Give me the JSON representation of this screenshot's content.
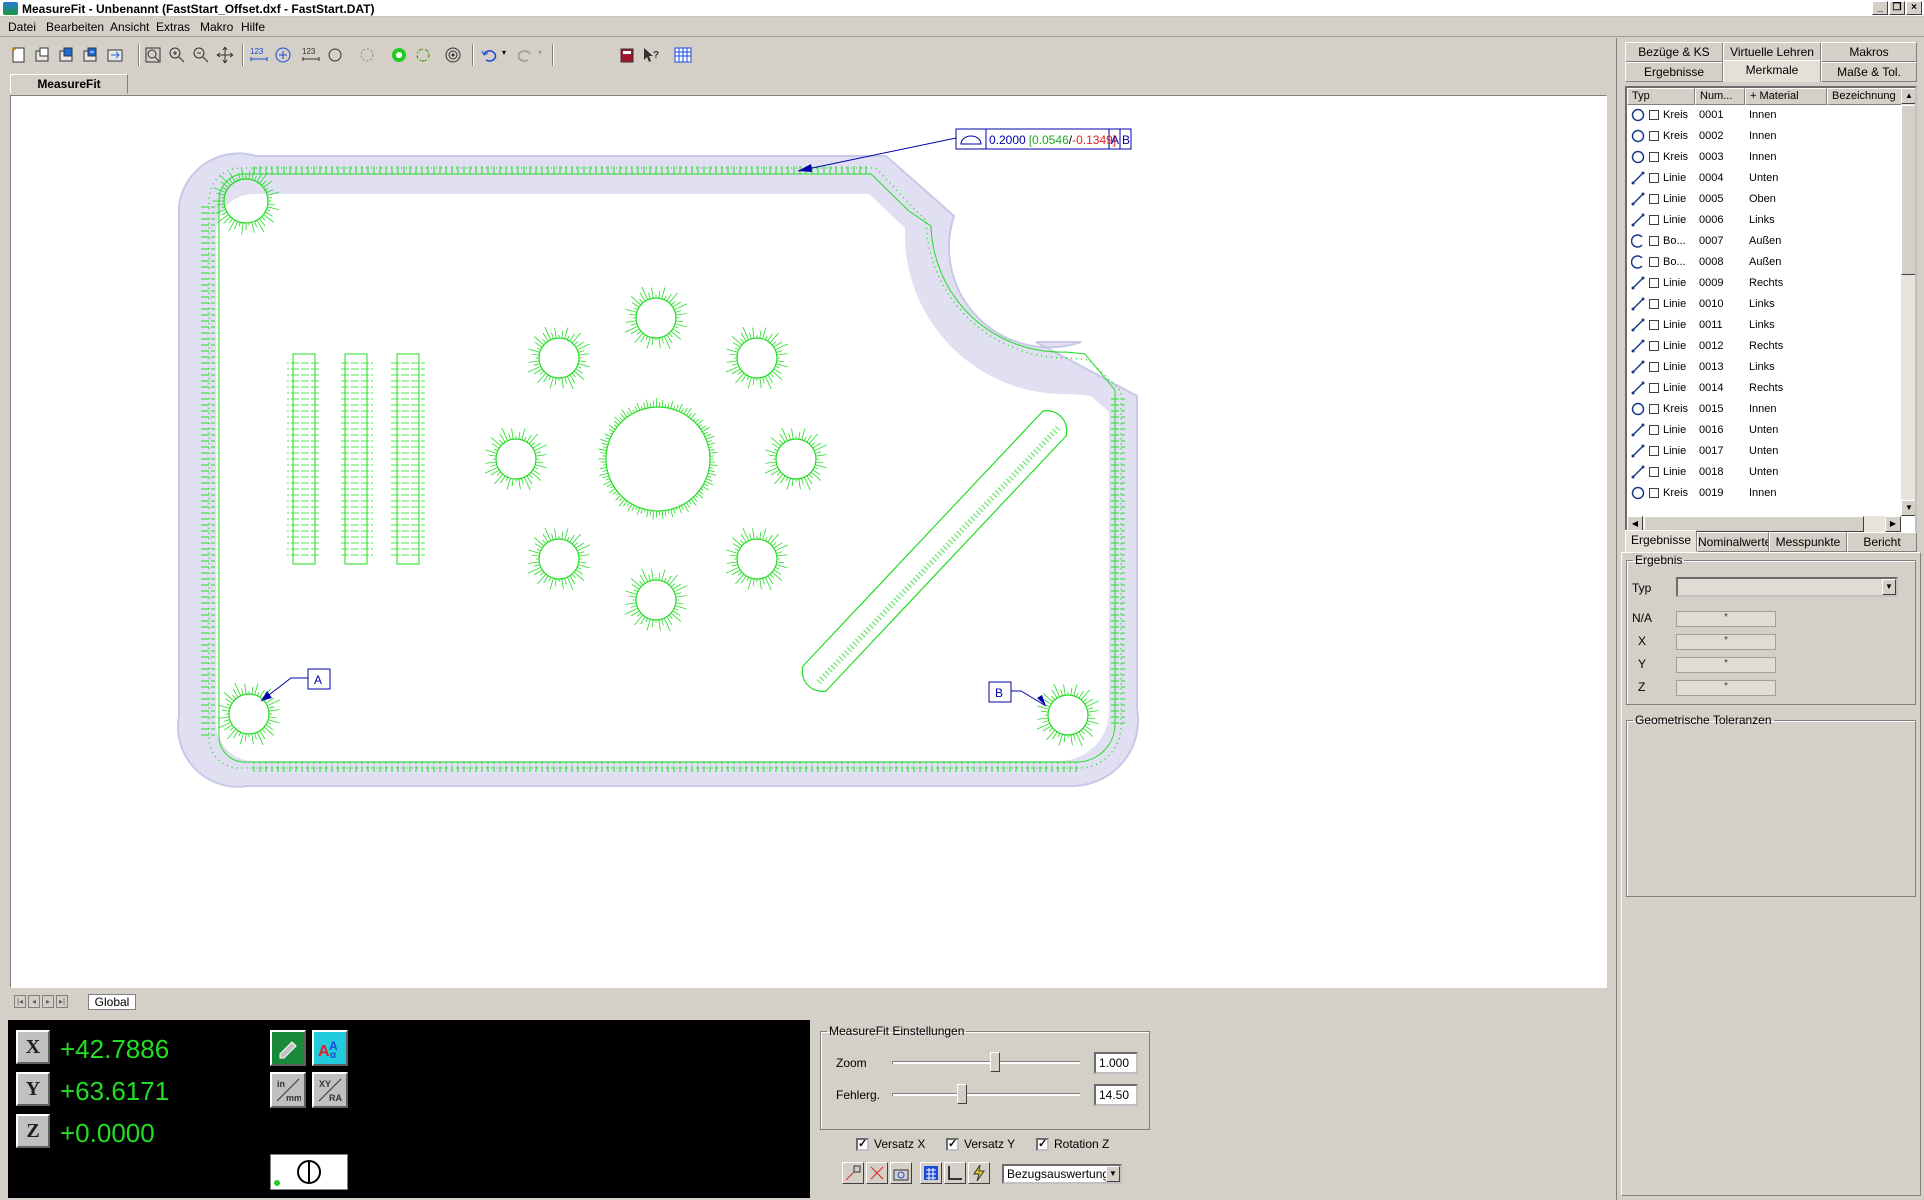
{
  "window": {
    "title": "MeasureFit - Unbenannt (FastStart_Offset.dxf - FastStart.DAT)"
  },
  "menu": [
    "Datei",
    "Bearbeiten",
    "Ansicht",
    "Extras",
    "Makro",
    "Hilfe"
  ],
  "doc_tab": "MeasureFit",
  "sheet_tab": "Global",
  "annotation": {
    "tolerance": "0.2000",
    "dev_open": "[",
    "dev_plus": "0.0546",
    "dev_sep": "/",
    "dev_minus": "-0.1349",
    "dev_close": "]",
    "datum_a": "A",
    "datum_b": "B"
  },
  "coords": {
    "x_label": "X",
    "x": "+42.7886",
    "y_label": "Y",
    "y": "+63.6171",
    "z_label": "Z",
    "z": "+0.0000"
  },
  "settings": {
    "group_title": "MeasureFit Einstellungen",
    "zoom_label": "Zoom",
    "zoom_value": "1.000",
    "zoom_level": 0.55,
    "fehlerg_label": "Fehlerg.",
    "fehlerg_value": "14.50",
    "fehlerg_level": 0.37,
    "versatz_x": "Versatz X",
    "versatz_y": "Versatz Y",
    "rotation_z": "Rotation Z",
    "bezug_select": "Bezugsauswertung"
  },
  "right_tabs_top": [
    "Bezüge & KS",
    "Virtuelle Lehren",
    "Makros",
    "Ergebnisse",
    "Merkmale",
    "Maße & Tol."
  ],
  "list_columns": [
    "Typ",
    "Num...",
    "+ Material",
    "Bezeichnung"
  ],
  "features": [
    {
      "type": "Kreis",
      "num": "0001",
      "material": "Innen",
      "icon": "circle-icon"
    },
    {
      "type": "Kreis",
      "num": "0002",
      "material": "Innen",
      "icon": "circle-icon"
    },
    {
      "type": "Kreis",
      "num": "0003",
      "material": "Innen",
      "icon": "circle-icon"
    },
    {
      "type": "Linie",
      "num": "0004",
      "material": "Unten",
      "icon": "line-icon"
    },
    {
      "type": "Linie",
      "num": "0005",
      "material": "Oben",
      "icon": "line-icon"
    },
    {
      "type": "Linie",
      "num": "0006",
      "material": "Links",
      "icon": "line-icon"
    },
    {
      "type": "Bo...",
      "num": "0007",
      "material": "Außen",
      "icon": "arc-icon"
    },
    {
      "type": "Bo...",
      "num": "0008",
      "material": "Außen",
      "icon": "arc-icon"
    },
    {
      "type": "Linie",
      "num": "0009",
      "material": "Rechts",
      "icon": "line-icon"
    },
    {
      "type": "Linie",
      "num": "0010",
      "material": "Links",
      "icon": "line-icon"
    },
    {
      "type": "Linie",
      "num": "0011",
      "material": "Links",
      "icon": "line-icon"
    },
    {
      "type": "Linie",
      "num": "0012",
      "material": "Rechts",
      "icon": "line-icon"
    },
    {
      "type": "Linie",
      "num": "0013",
      "material": "Links",
      "icon": "line-icon"
    },
    {
      "type": "Linie",
      "num": "0014",
      "material": "Rechts",
      "icon": "line-icon"
    },
    {
      "type": "Kreis",
      "num": "0015",
      "material": "Innen",
      "icon": "circle-icon"
    },
    {
      "type": "Linie",
      "num": "0016",
      "material": "Unten",
      "icon": "line-icon"
    },
    {
      "type": "Linie",
      "num": "0017",
      "material": "Unten",
      "icon": "line-icon"
    },
    {
      "type": "Linie",
      "num": "0018",
      "material": "Unten",
      "icon": "line-icon"
    },
    {
      "type": "Kreis",
      "num": "0019",
      "material": "Innen",
      "icon": "circle-icon"
    }
  ],
  "right_tabs_bottom": [
    "Ergebnisse",
    "Nominalwerte",
    "Messpunkte",
    "Bericht"
  ],
  "result": {
    "group_title": "Ergebnis",
    "typ_label": "Typ",
    "na_label": "N/A",
    "x_label": "X",
    "y_label": "Y",
    "z_label": "Z",
    "empty_value": "*"
  },
  "geo_tol_title": "Geometrische Toleranzen",
  "colors": {
    "measure_green": "#22dd22",
    "tolerance_zone": "#dcdcf0",
    "annotation_blue": "#0000aa",
    "deviation_red": "#dd2222"
  }
}
